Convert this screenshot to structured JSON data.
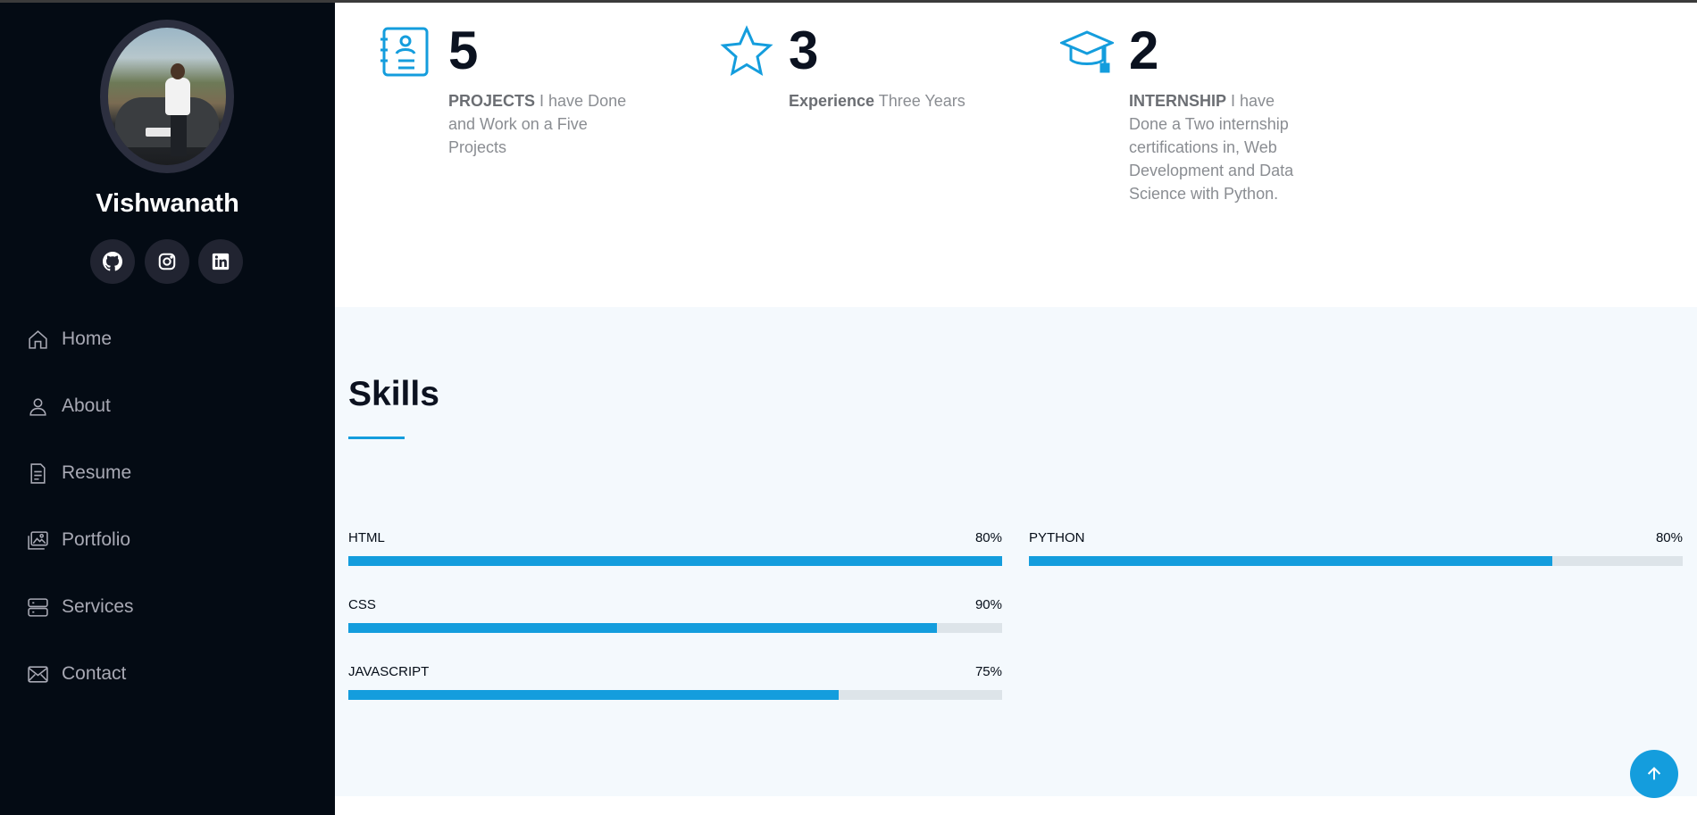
{
  "profile": {
    "name": "Vishwanath"
  },
  "social": [
    {
      "icon": "github-icon"
    },
    {
      "icon": "instagram-icon"
    },
    {
      "icon": "linkedin-icon"
    }
  ],
  "nav": {
    "items": [
      {
        "label": "Home",
        "icon": "home-icon"
      },
      {
        "label": "About",
        "icon": "person-icon"
      },
      {
        "label": "Resume",
        "icon": "file-text-icon"
      },
      {
        "label": "Portfolio",
        "icon": "images-icon"
      },
      {
        "label": "Services",
        "icon": "server-icon"
      },
      {
        "label": "Contact",
        "icon": "envelope-icon"
      }
    ]
  },
  "facts": [
    {
      "icon": "journal-icon",
      "number": "5",
      "bold": "PROJECTS",
      "text": " I have Done and Work on a Five Projects"
    },
    {
      "icon": "star-icon",
      "number": "3",
      "bold": "Experience",
      "text": " Three Years"
    },
    {
      "icon": "graduation-cap-icon",
      "number": "2",
      "bold": "INTERNSHIP",
      "text": " I have Done a Two internship certifications in, Web Development and Data Science with Python."
    }
  ],
  "skills": {
    "title": "Skills",
    "items": [
      {
        "name": "HTML",
        "percent_label": "80%",
        "fill": 1.0
      },
      {
        "name": "CSS",
        "percent_label": "90%",
        "fill": 0.9
      },
      {
        "name": "JAVASCRIPT",
        "percent_label": "75%",
        "fill": 0.75
      },
      {
        "name": "PYTHON",
        "percent_label": "80%",
        "fill": 0.8
      }
    ]
  },
  "colors": {
    "accent": "#149ddd",
    "sidebar": "#040b14",
    "section_bg": "#f4f9fd"
  }
}
